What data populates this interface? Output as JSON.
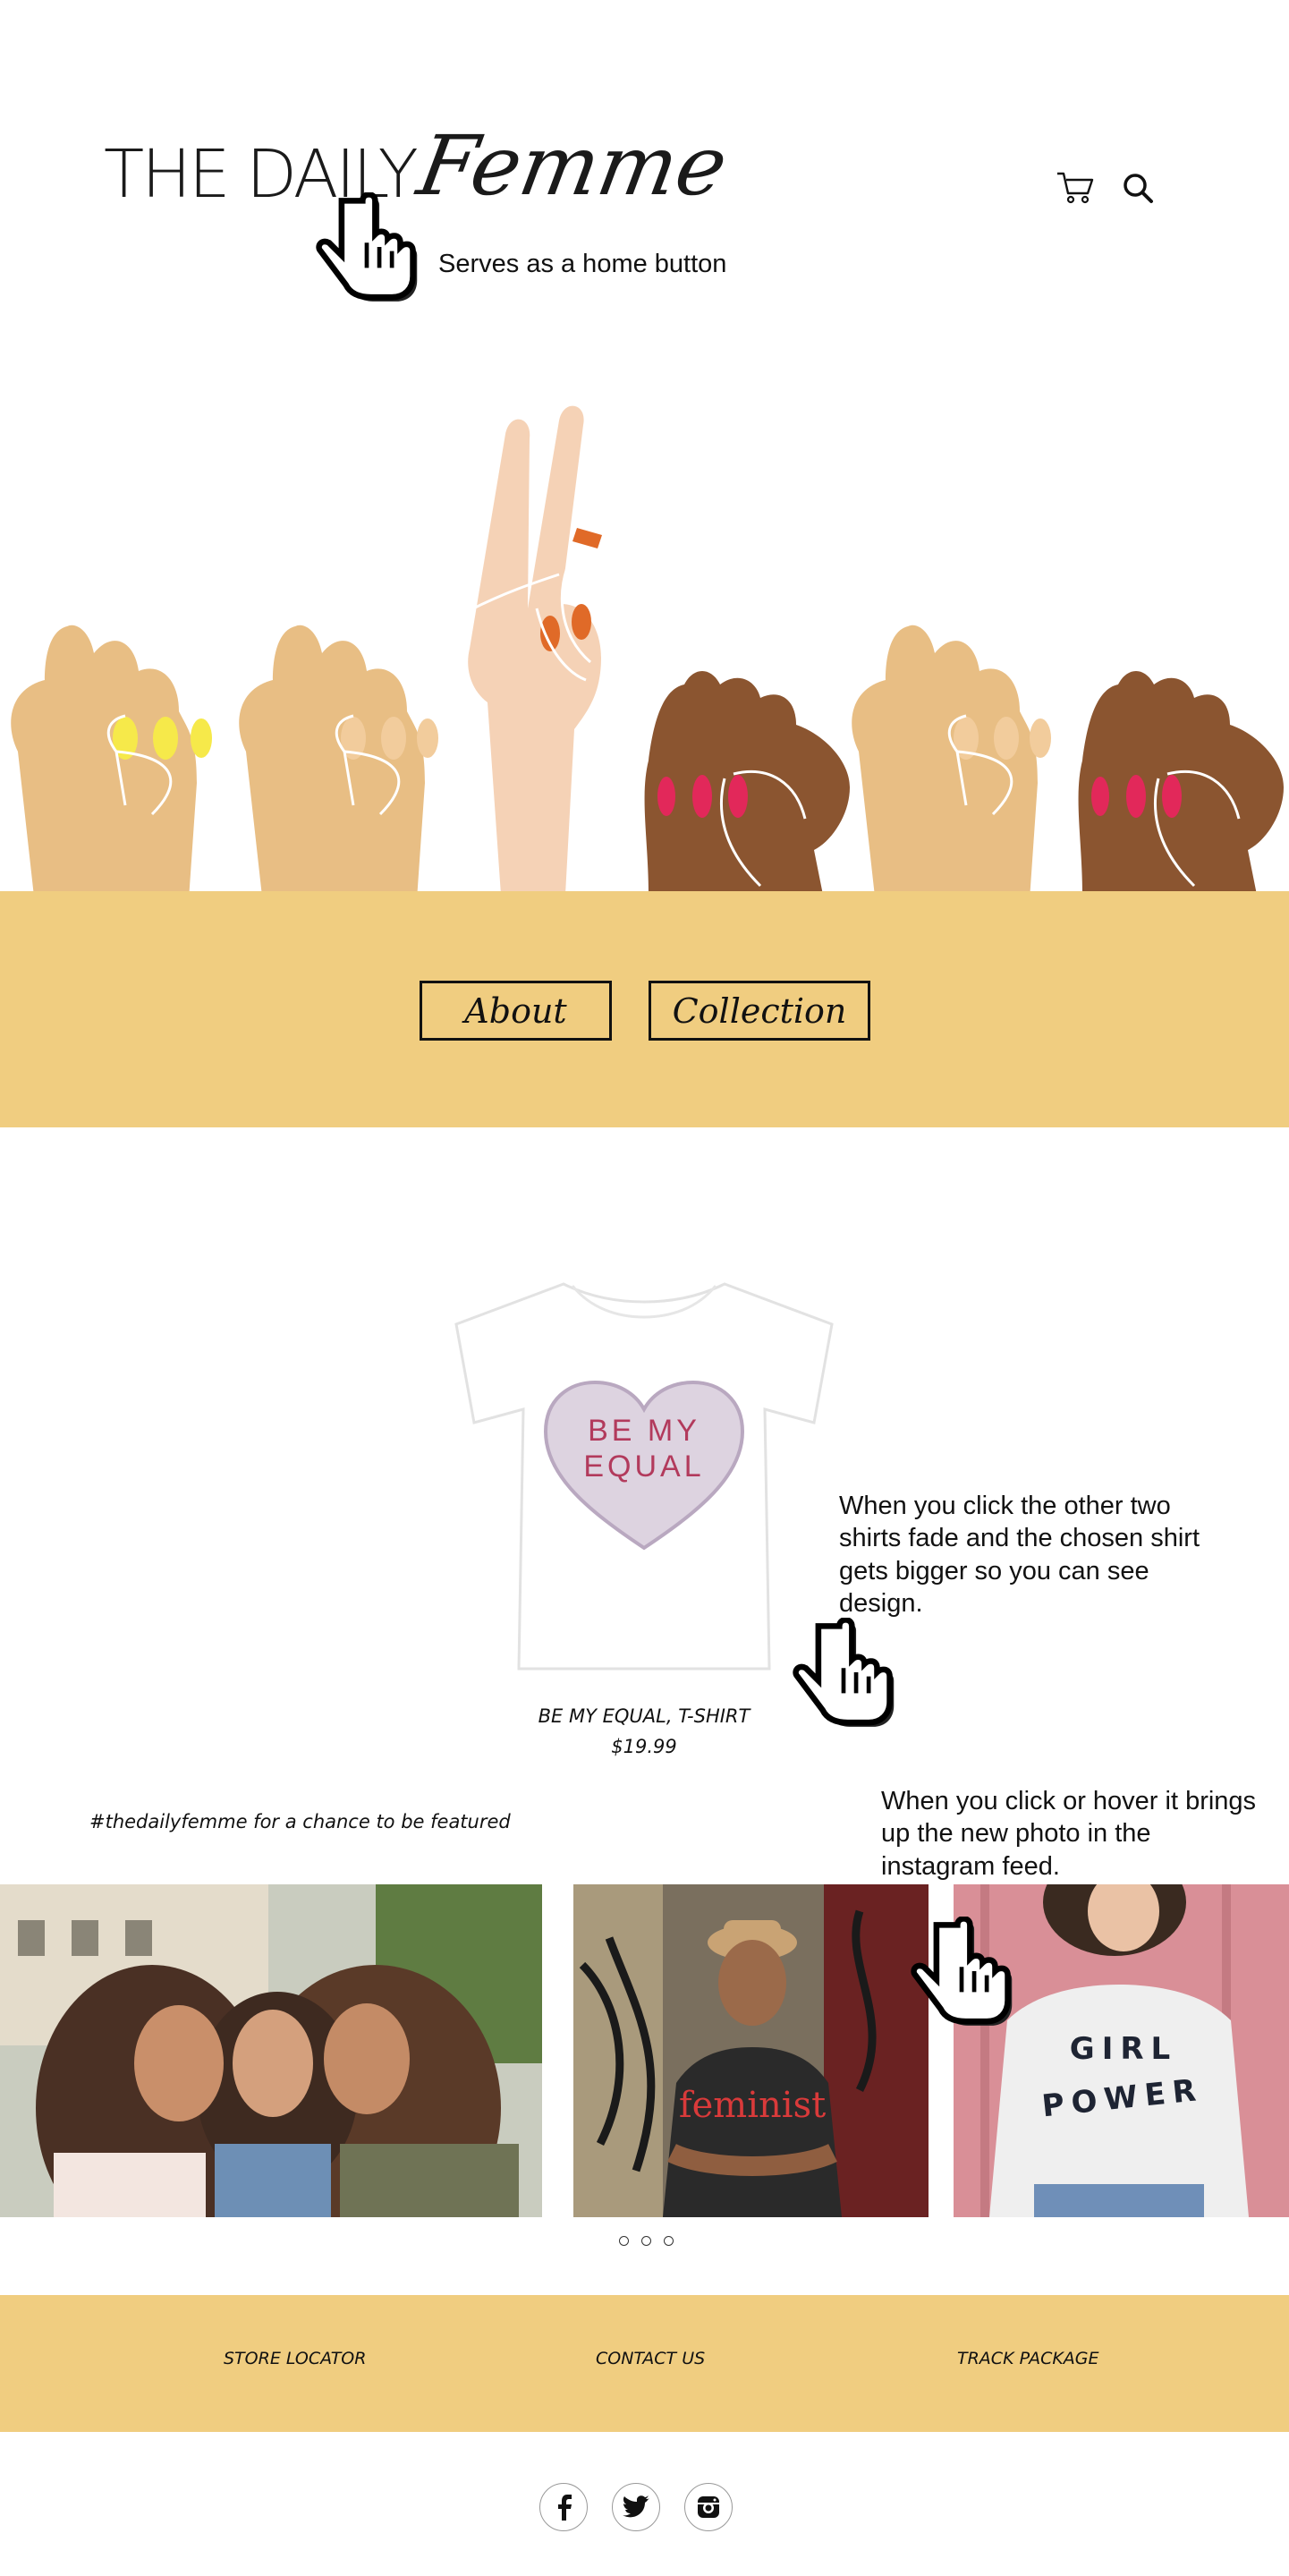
{
  "header": {
    "logo_plain": "THE DAILY",
    "logo_script": "Femme",
    "home_note": "Serves as a home button",
    "icons": [
      "cart-icon",
      "search-icon"
    ]
  },
  "nav": {
    "about_label": "About",
    "collection_label": "Collection"
  },
  "featured": {
    "shirt_print": [
      "BE MY",
      "EQUAL"
    ],
    "product_name": "BE MY EQUAL, T-SHIRT",
    "price": "$19.99",
    "note": "When you click the other two shirts fade and the chosen shirt gets bigger so you can see design."
  },
  "instagram": {
    "tagline": "#thedailyfemme for a chance to be featured",
    "note": "When you click or hover it brings up the new photo in the instagram feed.",
    "photo2_shirt_text": "feminist",
    "photo3_shirt_text": [
      "GIRL",
      "POWER"
    ],
    "dot_count": 3
  },
  "footer": {
    "links": [
      "STORE LOCATOR",
      "CONTACT US",
      "TRACK PACKAGE"
    ],
    "social_icons": [
      "facebook-icon",
      "twitter-icon",
      "instagram-icon"
    ]
  },
  "colors": {
    "band": "#f0cd80",
    "skin_light": "#e8be84",
    "skin_pale": "#f5d2b6",
    "skin_dark": "#8b5530",
    "nail_yellow": "#f6e94a",
    "nail_orange": "#e06a28",
    "nail_red": "#e2285a"
  }
}
